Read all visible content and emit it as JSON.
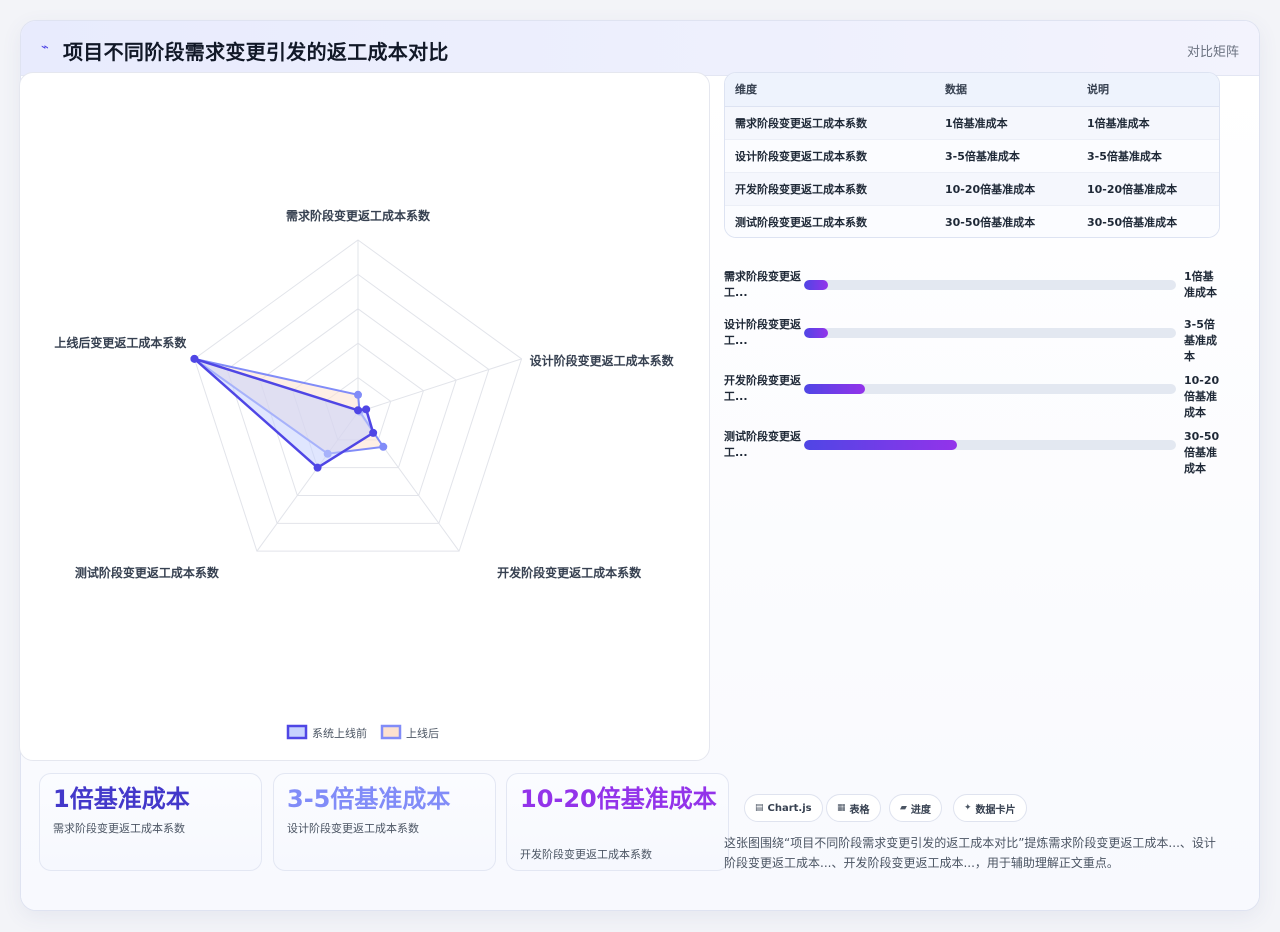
{
  "header": {
    "title": "项目不同阶段需求变更引发的返工成本对比",
    "tag": "对比矩阵",
    "icon": "trend-icon"
  },
  "chart_data": {
    "type": "radar",
    "axes": [
      "需求阶段变更返工成本系数",
      "设计阶段变更返工成本系数",
      "开发阶段变更返工成本系数",
      "测试阶段变更返工成本系数",
      "上线后变更返工成本系数"
    ],
    "rmax": 100,
    "rings": 5,
    "series": [
      {
        "name": "系统上线前",
        "values": [
          1,
          5,
          15,
          40,
          100
        ],
        "stroke": "#4f46e5",
        "fill": "#c7d2fe"
      },
      {
        "name": "上线后",
        "values": [
          10,
          1,
          25,
          30,
          100
        ],
        "stroke": "#818cf8",
        "fill": "#fde1cf"
      }
    ],
    "legend": "bottom"
  },
  "kpis": [
    {
      "value": "1倍基准成本",
      "label": "需求阶段变更返工成本系数",
      "color": "#4338ca"
    },
    {
      "value": "3-5倍基准成本",
      "label": "设计阶段变更返工成本系数",
      "color": "#818cf8"
    },
    {
      "value": "10-20倍基准成本",
      "label": "开发阶段变更返工成本系数",
      "color": "#9333ea"
    }
  ],
  "table": {
    "headers": [
      "维度",
      "数据",
      "说明"
    ],
    "rows": [
      [
        "需求阶段变更返工成本系数",
        "1倍基准成本",
        "1倍基准成本"
      ],
      [
        "设计阶段变更返工成本系数",
        "3-5倍基准成本",
        "3-5倍基准成本"
      ],
      [
        "开发阶段变更返工成本系数",
        "10-20倍基准成本",
        "10-20倍基准成本"
      ],
      [
        "测试阶段变更返工成本系数",
        "30-50倍基准成本",
        "30-50倍基准成本"
      ]
    ]
  },
  "progress": [
    {
      "label": "需求阶段变更返工...",
      "value": "1倍基准成本",
      "fraction": 0.065
    },
    {
      "label": "设计阶段变更返工...",
      "value": "3-5倍基准成本",
      "fraction": 0.065
    },
    {
      "label": "开发阶段变更返工...",
      "value": "10-20倍基准成本",
      "fraction": 0.165
    },
    {
      "label": "测试阶段变更返工...",
      "value": "30-50倍基准成本",
      "fraction": 0.41
    }
  ],
  "chips": [
    {
      "icon": "chart-icon",
      "glyph": "▤",
      "label": "Chart.js"
    },
    {
      "icon": "table-icon",
      "glyph": "▦",
      "label": "表格"
    },
    {
      "icon": "progress-icon",
      "glyph": "▰",
      "label": "进度"
    },
    {
      "icon": "card-icon",
      "glyph": "✦",
      "label": "数据卡片"
    }
  ],
  "note": "这张图围绕“项目不同阶段需求变更引发的返工成本对比”提炼需求阶段变更返工成本...、设计阶段变更返工成本...、开发阶段变更返工成本...，用于辅助理解正文重点。"
}
